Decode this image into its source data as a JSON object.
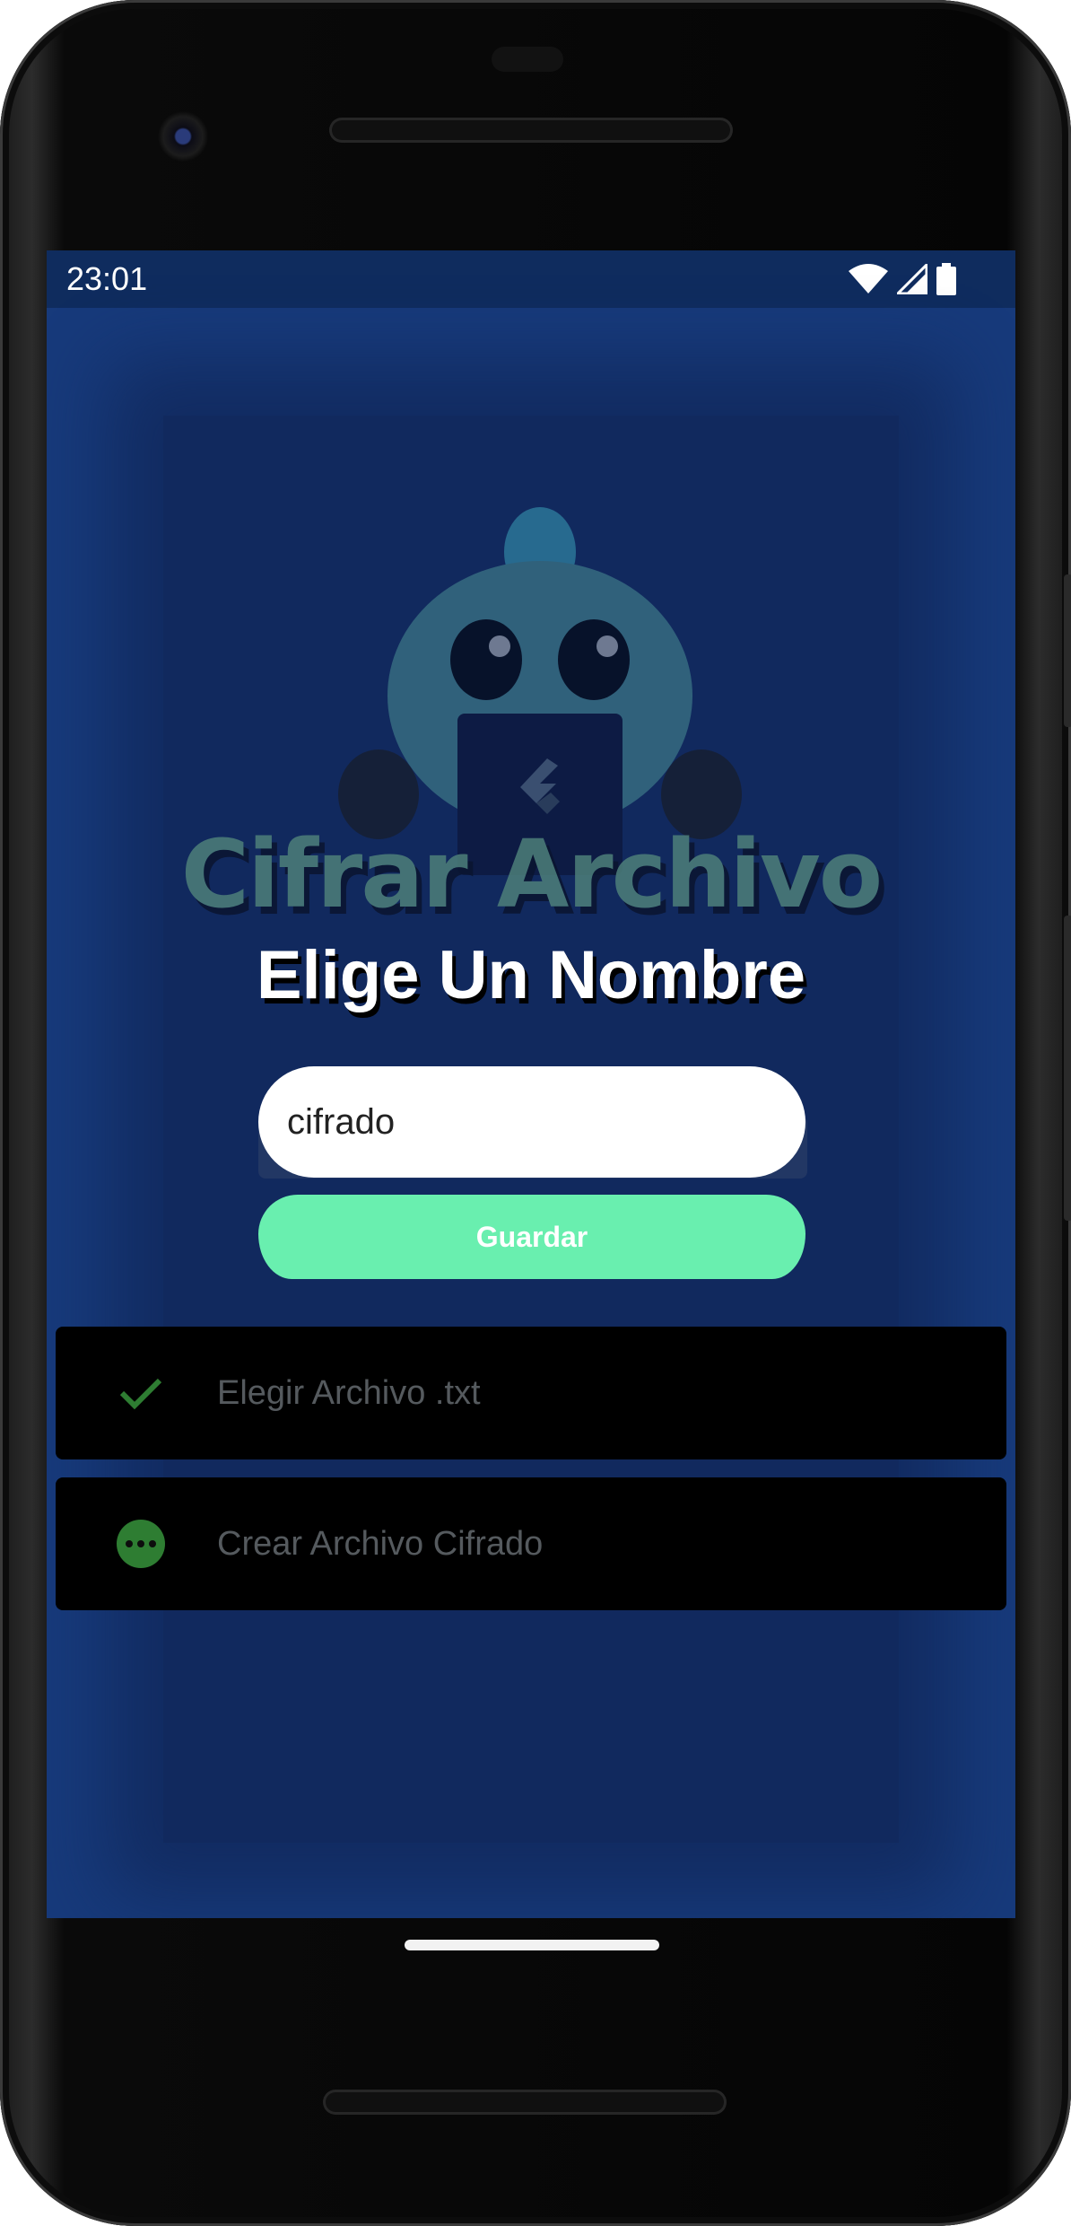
{
  "status_bar": {
    "time": "23:01",
    "icons": [
      "wifi-icon",
      "cell-signal-icon",
      "battery-icon"
    ]
  },
  "background": {
    "title": "Cifrar Archivo",
    "mascot": "flutter-dash-mascot-with-laptop"
  },
  "dialog": {
    "title": "Elige Un Nombre",
    "input_value": "cifrado",
    "save_label": "Guardar"
  },
  "steps": [
    {
      "label": "Elegir Archivo .txt",
      "icon": "check-icon",
      "status": "done"
    },
    {
      "label": "Crear Archivo Cifrado",
      "icon": "more-horiz-icon",
      "status": "pending"
    }
  ],
  "colors": {
    "background": "#173a7b",
    "status_bar": "#0f2c5e",
    "accent_green": "#69efaf",
    "step_icon_green": "#2e7d32"
  }
}
